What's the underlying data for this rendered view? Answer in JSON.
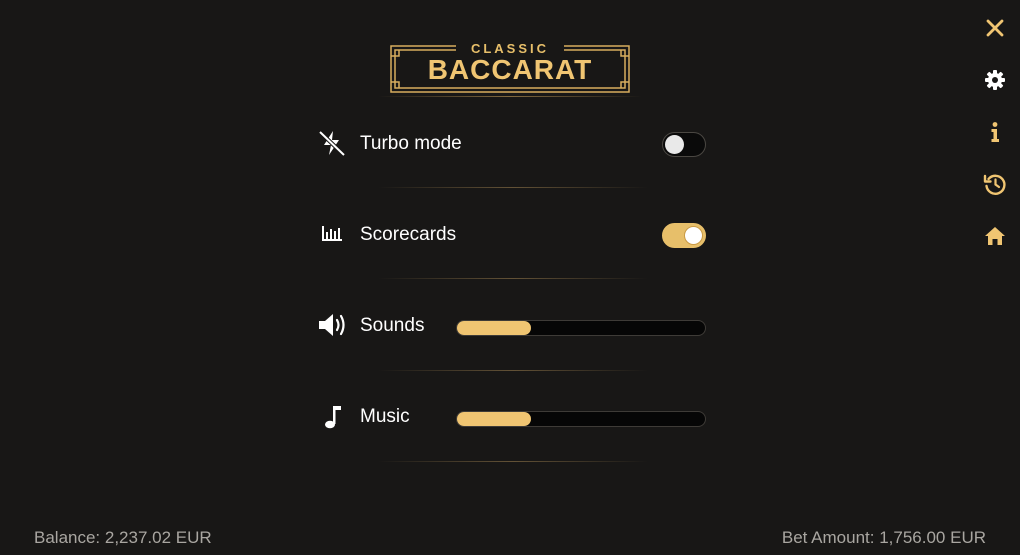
{
  "logo": {
    "small_text": "CLASSIC",
    "big_text": "BACCARAT"
  },
  "settings": {
    "turbo": {
      "label": "Turbo mode",
      "icon": "turbo-off-icon",
      "enabled": false
    },
    "scorecards": {
      "label": "Scorecards",
      "icon": "bar-chart-icon",
      "enabled": true
    },
    "sounds": {
      "label": "Sounds",
      "icon": "speaker-icon",
      "level": 0.3
    },
    "music": {
      "label": "Music",
      "icon": "music-note-icon",
      "level": 0.3
    }
  },
  "side_menu": [
    "close-icon",
    "gear-icon",
    "info-icon",
    "history-icon",
    "home-icon"
  ],
  "footer": {
    "balance": "Balance: 2,237.02 EUR",
    "bet_amount": "Bet Amount: 1,756.00 EUR"
  },
  "colors": {
    "accent": "#f0c572",
    "background": "#181716",
    "footer_text": "#a9a6a1"
  }
}
